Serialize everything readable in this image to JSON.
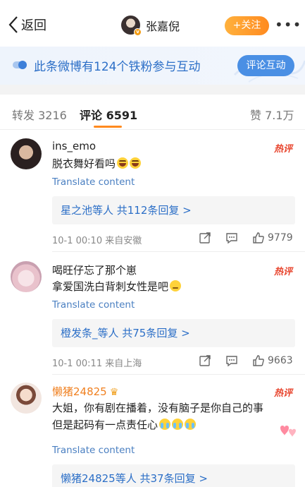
{
  "header": {
    "back_label": "返回",
    "author_name": "张嘉倪",
    "follow_label": "+关注",
    "more_label": "•••"
  },
  "banner": {
    "text": "此条微博有124个铁粉参与互动",
    "button_label": "评论互动"
  },
  "tabs": {
    "repost": "转发 3216",
    "comments": "评论 6591",
    "likes": "赞 7.1万"
  },
  "hot_label": "热评",
  "comments": [
    {
      "name": "ins_emo",
      "text": "脱衣舞好看吗",
      "translate": "Translate content",
      "replies": "星之池等人 共112条回复 >",
      "meta": "10-1 00:10 来自安徽",
      "likes": "9779"
    },
    {
      "name": "喝旺仔忘了那个崽",
      "text": "拿爱国洗白背刺女性是吧",
      "translate": "Translate content",
      "replies": "橙发条_等人 共75条回复 >",
      "meta": "10-1 00:11 来自上海",
      "likes": "9663"
    },
    {
      "name": "懒猪24825",
      "text_line1": "大姐，你有剧在播着，没有脑子是你自己的事",
      "text_line2": "但是起码有一点责任心",
      "translate": "Translate content",
      "replies": "懒猪24825等人 共37条回复 >"
    }
  ],
  "colors": {
    "accent_orange": "#ff8a1f",
    "link_blue": "#2c6fc7",
    "hot_red": "#e8462f"
  }
}
